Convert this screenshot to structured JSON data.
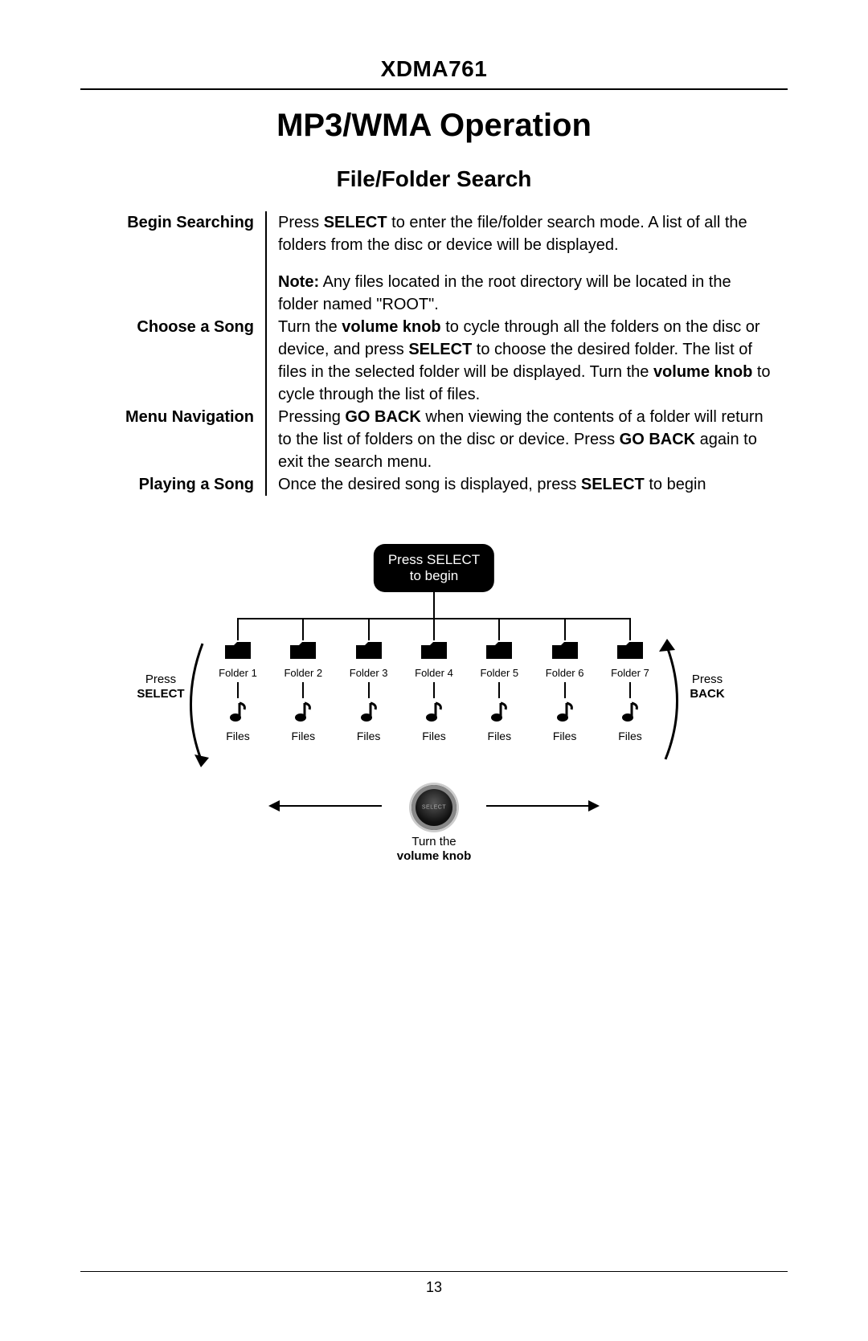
{
  "header": {
    "model": "XDMA761"
  },
  "titles": {
    "main": "MP3/WMA Operation",
    "sub": "File/Folder Search"
  },
  "sections": [
    {
      "label": "Begin Searching",
      "body": [
        {
          "runs": [
            {
              "t": "Press ",
              "b": false
            },
            {
              "t": "SELECT",
              "b": true
            },
            {
              "t": " to enter the file/folder search mode. A list of all the folders from the disc or device will be displayed.",
              "b": false
            }
          ]
        },
        {
          "runs": [
            {
              "t": "Note:",
              "b": true
            },
            {
              "t": " Any files located in the root directory will be located in the folder named \"ROOT\".",
              "b": false
            }
          ]
        }
      ]
    },
    {
      "label": "Choose a Song",
      "body": [
        {
          "runs": [
            {
              "t": "Turn the ",
              "b": false
            },
            {
              "t": "volume knob",
              "b": true
            },
            {
              "t": " to cycle through all the folders on the disc or device, and press ",
              "b": false
            },
            {
              "t": "SELECT",
              "b": true
            },
            {
              "t": " to choose the desired folder. The list of files in the selected folder will be displayed. Turn the ",
              "b": false
            },
            {
              "t": "volume knob",
              "b": true
            },
            {
              "t": " to cycle through the list of files.",
              "b": false
            }
          ]
        }
      ]
    },
    {
      "label": "Menu Navigation",
      "body": [
        {
          "runs": [
            {
              "t": "Pressing ",
              "b": false
            },
            {
              "t": "GO BACK",
              "b": true
            },
            {
              "t": " when viewing the contents of a folder will return to the list of folders on the disc or device. Press ",
              "b": false
            },
            {
              "t": "GO BACK",
              "b": true
            },
            {
              "t": " again to exit the search menu.",
              "b": false
            }
          ]
        }
      ]
    },
    {
      "label": "Playing a Song",
      "body": [
        {
          "runs": [
            {
              "t": "Once the desired song is displayed, press ",
              "b": false
            },
            {
              "t": "SELECT",
              "b": true
            },
            {
              "t": " to begin",
              "b": false
            }
          ]
        }
      ]
    }
  ],
  "diagram": {
    "begin_line1": "Press SELECT",
    "begin_line2": "to begin",
    "folders": [
      {
        "label": "Folder 1",
        "files": "Files"
      },
      {
        "label": "Folder 2",
        "files": "Files"
      },
      {
        "label": "Folder 3",
        "files": "Files"
      },
      {
        "label": "Folder 4",
        "files": "Files"
      },
      {
        "label": "Folder 5",
        "files": "Files"
      },
      {
        "label": "Folder 6",
        "files": "Files"
      },
      {
        "label": "Folder 7",
        "files": "Files"
      }
    ],
    "left_side_line1": "Press",
    "left_side_line2": "SELECT",
    "right_side_line1": "Press",
    "right_side_line2": "BACK",
    "knob_text": "SELECT",
    "turn_line1": "Turn the",
    "turn_line2": "volume knob"
  },
  "footer": {
    "page": "13"
  }
}
